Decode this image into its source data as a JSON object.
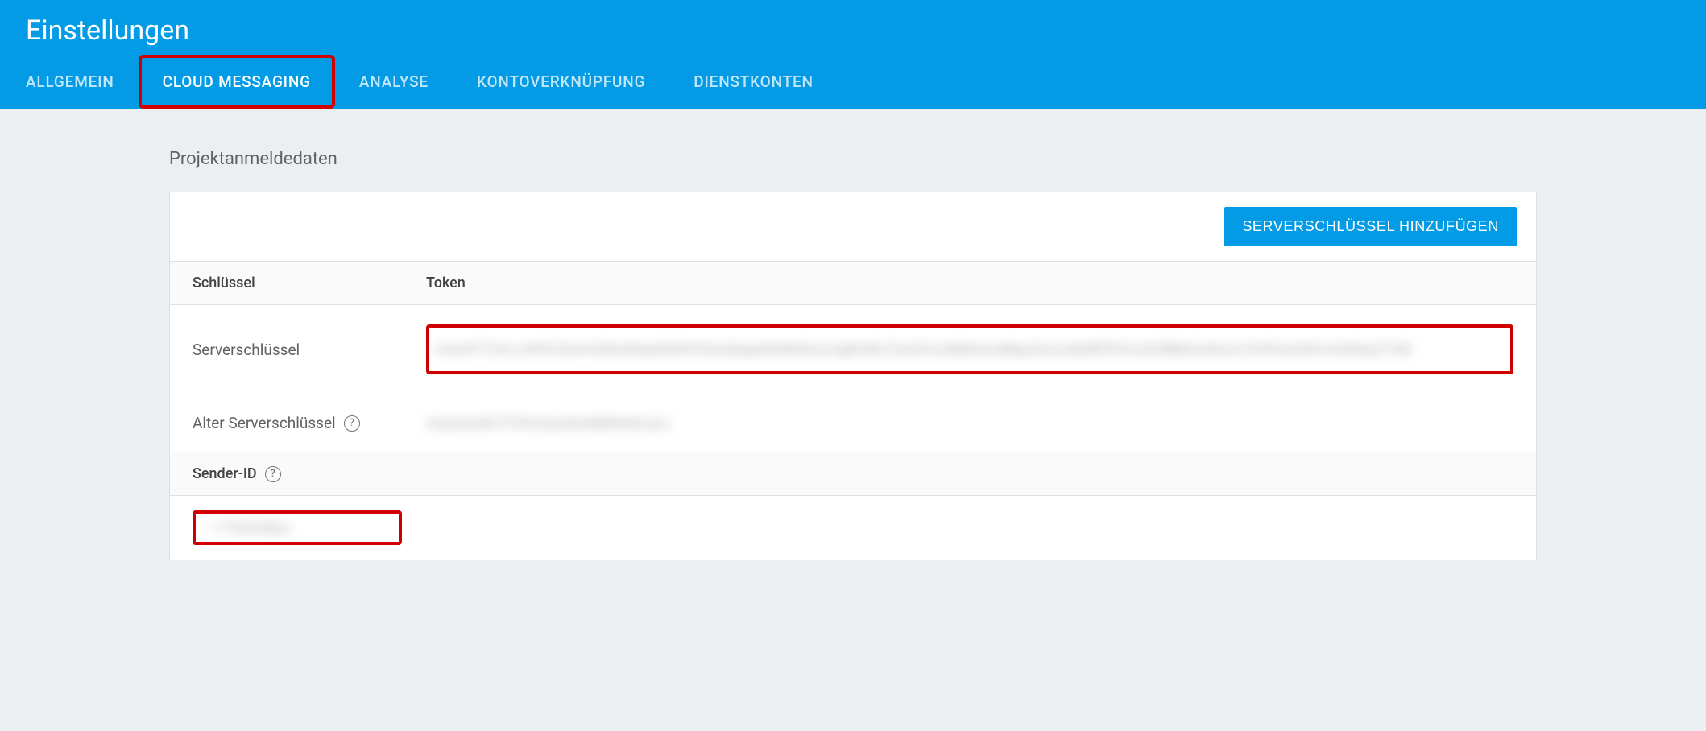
{
  "header": {
    "title": "Einstellungen",
    "tabs": [
      {
        "label": "ALLGEMEIN",
        "active": false
      },
      {
        "label": "CLOUD MESSAGING",
        "active": true
      },
      {
        "label": "ANALYSE",
        "active": false
      },
      {
        "label": "KONTOVERKNÜPFUNG",
        "active": false
      },
      {
        "label": "DIENSTKONTEN",
        "active": false
      }
    ]
  },
  "section": {
    "title": "Projektanmeldedaten",
    "add_button": "SERVERSCHLÜSSEL HINZUFÜGEN",
    "columns": {
      "key": "Schlüssel",
      "token": "Token"
    },
    "rows": [
      {
        "label": "Serverschlüssel",
        "token_redacted": "AAAAFTY3oLLAPA91bHnmHRnadHpyWlrWVPdsVqHpgxMS0N0HucxwjjtKsKb1FyyCEVcuMb8ckrckBtjpzKUuszfgHBFfFfmxzXHfBljhHzdlrownTHSFUsshSFnmiOlbtrgVTvhB"
      },
      {
        "label": "Alter Serverschlüssel",
        "has_help": true,
        "token_redacted": "AIzaSyAxRG7THFGrujowKUMdNhhkGLqLo"
      }
    ],
    "sender_id_label": "Sender-ID",
    "sender_id_redacted": "177036288xx"
  }
}
